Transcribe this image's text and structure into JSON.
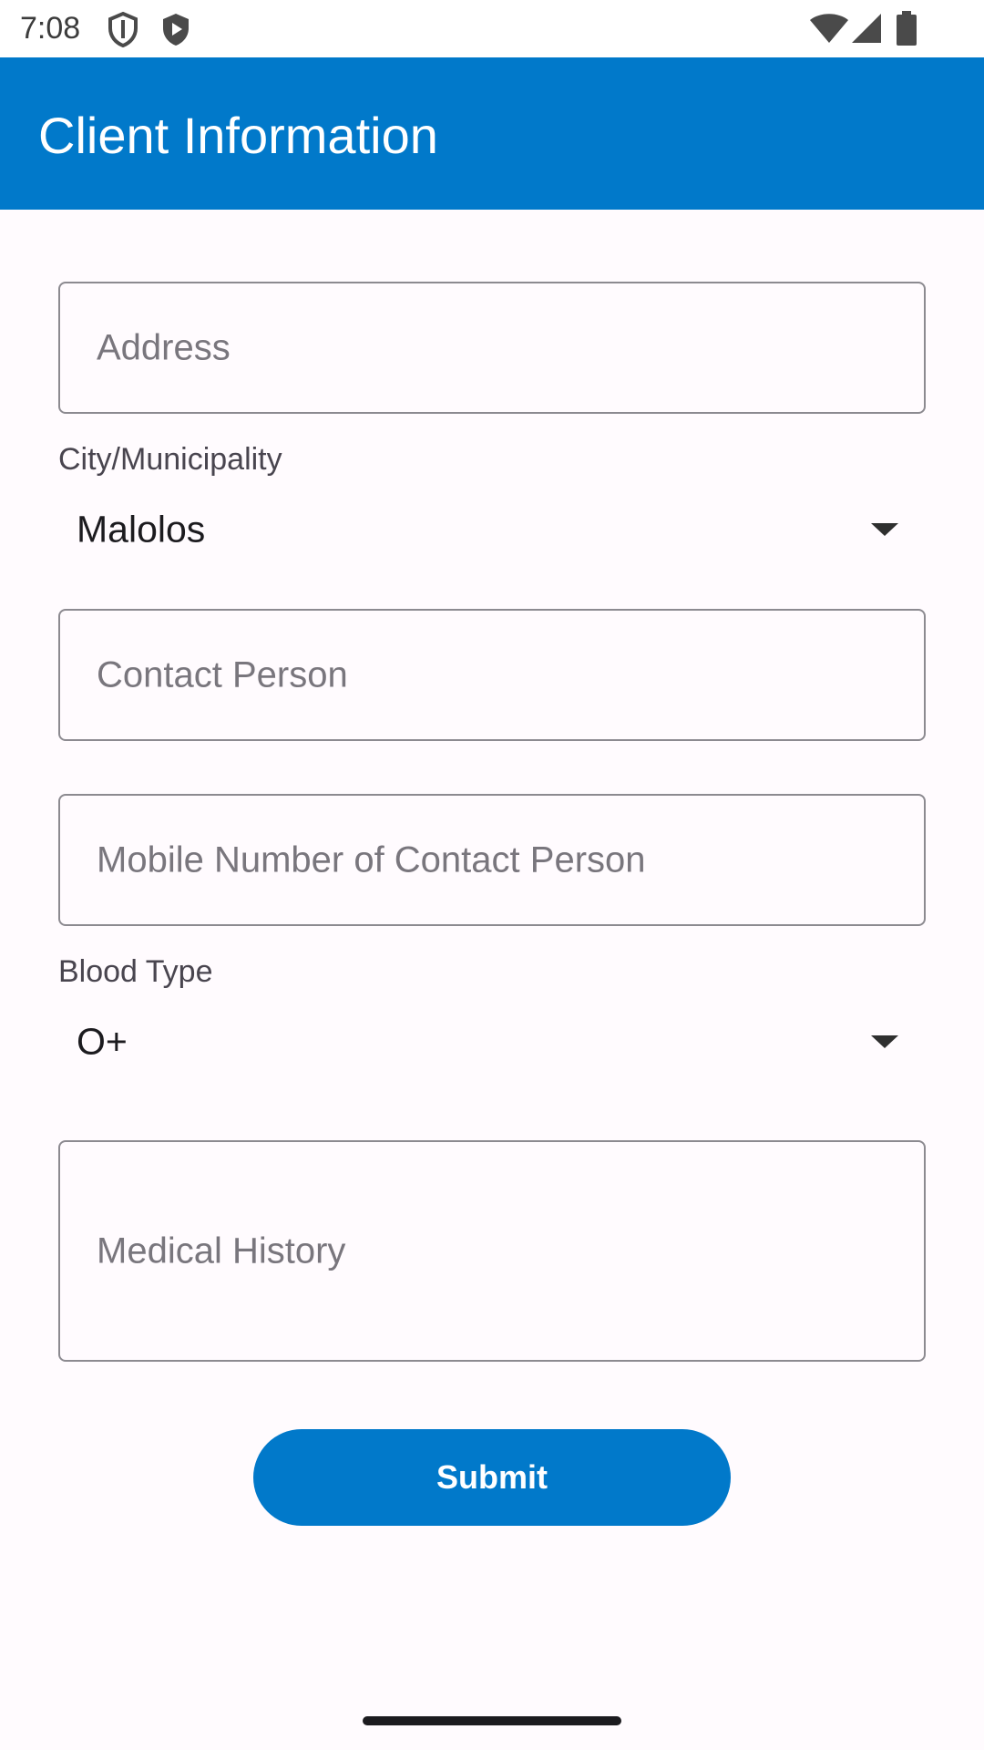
{
  "status_bar": {
    "time": "7:08",
    "icons": [
      "shield-outline-icon",
      "shield-play-icon",
      "wifi-icon",
      "signal-icon",
      "battery-icon"
    ]
  },
  "app_bar": {
    "title": "Client Information",
    "color": "#0179ca"
  },
  "form": {
    "address": {
      "placeholder": "Address",
      "value": ""
    },
    "city": {
      "label": "City/Municipality",
      "selected": "Malolos"
    },
    "contact_person": {
      "placeholder": "Contact Person",
      "value": ""
    },
    "contact_mobile": {
      "placeholder": "Mobile Number of Contact Person",
      "value": ""
    },
    "blood_type": {
      "label": "Blood Type",
      "selected": "O+"
    },
    "medical_history": {
      "placeholder": "Medical History",
      "value": ""
    },
    "submit_label": "Submit"
  },
  "colors": {
    "accent": "#0179ca",
    "background": "#fffbfe",
    "outline": "#8c8a90"
  }
}
